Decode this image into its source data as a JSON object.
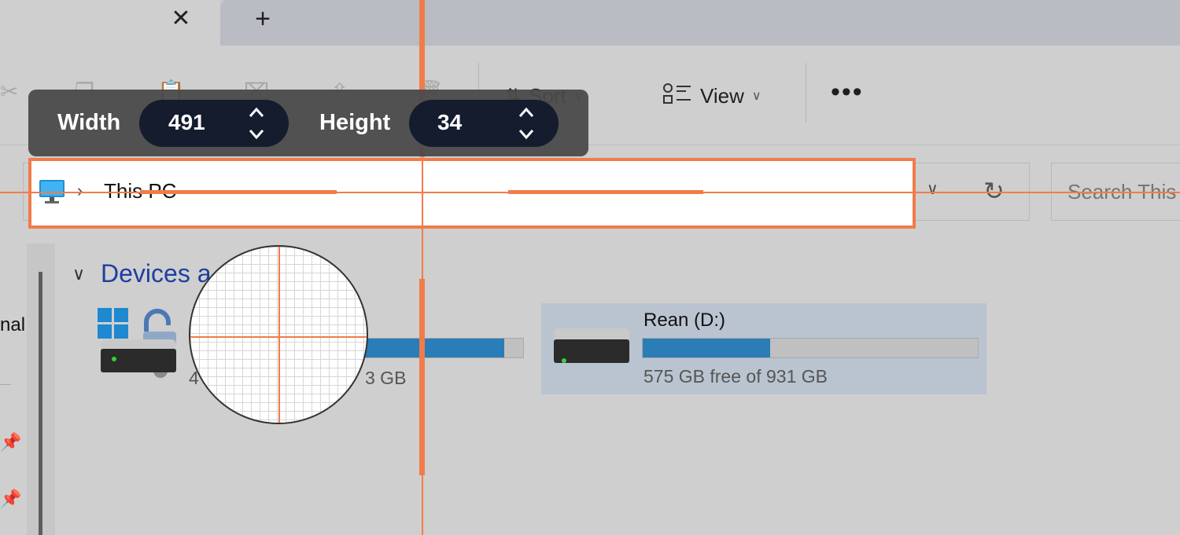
{
  "tabs": {
    "close_glyph": "✕",
    "new_tab_glyph": "+"
  },
  "toolbar": {
    "sort_label": "Sort",
    "view_label": "View",
    "more_glyph": "•••",
    "icons": [
      "cut-icon",
      "copy-icon",
      "paste-icon",
      "rename-icon",
      "share-icon",
      "delete-icon",
      "sort-icon",
      "view-icon"
    ]
  },
  "address_bar": {
    "location_icon": "this-pc-icon",
    "separator": "›",
    "crumb": "This PC",
    "search_placeholder": "Search This"
  },
  "nav_pane": {
    "partial_label": "nal"
  },
  "content": {
    "group_title": "Devices a",
    "drives": [
      {
        "name": "",
        "space_text": "4",
        "space_text_tail": "3 GB",
        "used_fraction": 0.88
      },
      {
        "name": "Rean (D:)",
        "space_text": "575 GB free of 931 GB",
        "used_fraction": 0.38
      }
    ]
  },
  "measure": {
    "width_label": "Width",
    "width_value": "491",
    "height_label": "Height",
    "height_value": "34"
  },
  "colors": {
    "accent_orange": "#f07c4a",
    "usage_bar": "#2a7db6",
    "selected_tile": "#bac4d0"
  }
}
